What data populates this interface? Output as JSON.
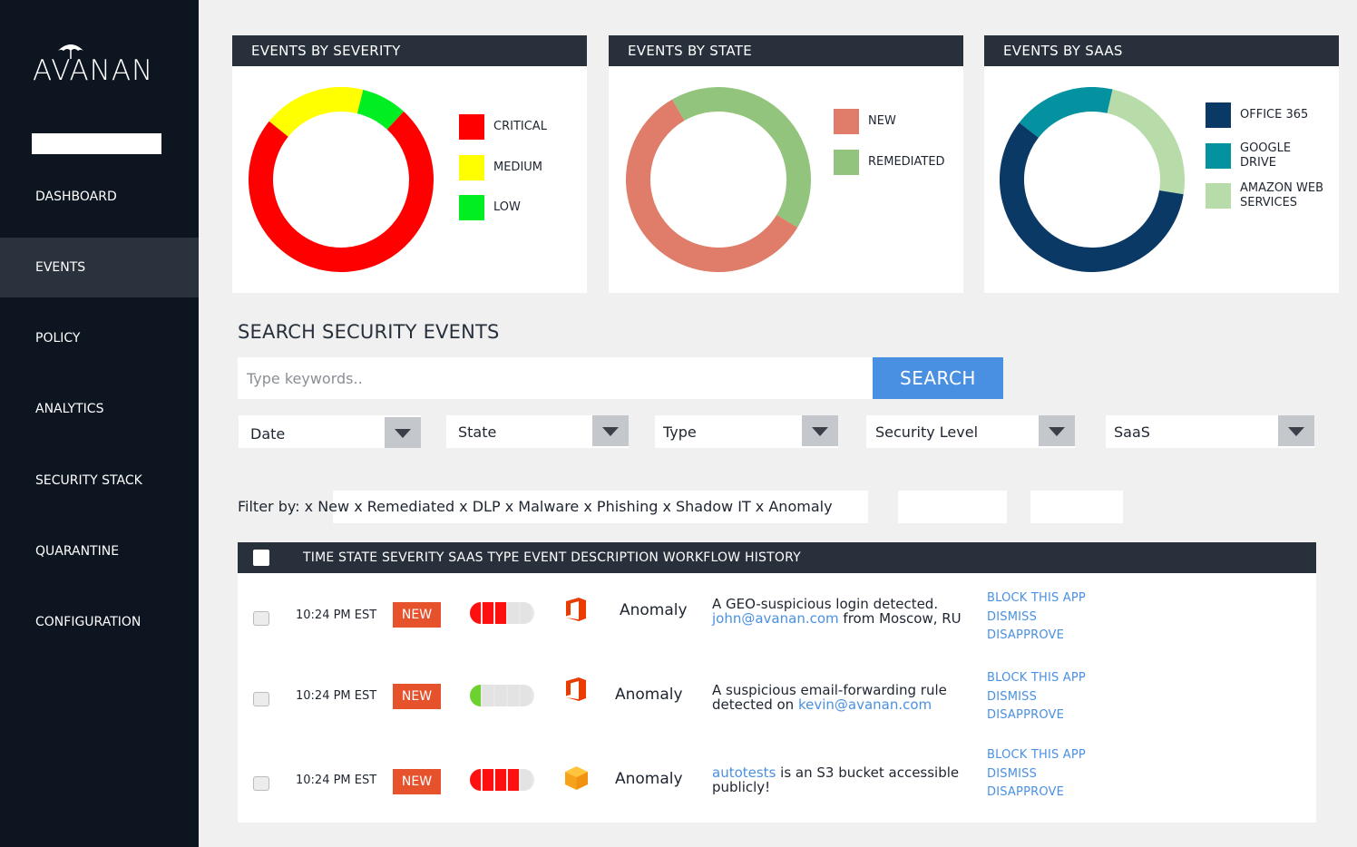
{
  "app": {
    "name": "AVANAN"
  },
  "sidebar": {
    "search_value": "",
    "items": [
      {
        "label": "DASHBOARD",
        "active": false
      },
      {
        "label": "EVENTS",
        "active": true
      },
      {
        "label": "POLICY",
        "active": false
      },
      {
        "label": "ANALYTICS",
        "active": false
      },
      {
        "label": "SECURITY STACK",
        "active": false
      },
      {
        "label": "QUARANTINE",
        "active": false
      },
      {
        "label": "CONFIGURATION",
        "active": false
      }
    ]
  },
  "panels": [
    {
      "title": "EVENTS BY SEVERITY",
      "legend": [
        {
          "label": "CRITICAL",
          "color": "#ff0000"
        },
        {
          "label": "MEDIUM",
          "color": "#ffff00"
        },
        {
          "label": "LOW",
          "color": "#00ee22"
        }
      ]
    },
    {
      "title": "EVENTS BY STATE",
      "legend": [
        {
          "label": "NEW",
          "color": "#e07d6a"
        },
        {
          "label": "REMEDIATED",
          "color": "#93c47d"
        }
      ]
    },
    {
      "title": "EVENTS BY SAAS",
      "legend": [
        {
          "label": "OFFICE 365",
          "color": "#0b3966"
        },
        {
          "label": "GOOGLE DRIVE",
          "color": "#0592a0"
        },
        {
          "label": "AMAZON WEB SERVICES",
          "color": "#b7dba9"
        }
      ]
    }
  ],
  "chart_data": [
    {
      "type": "pie",
      "title": "EVENTS BY SEVERITY",
      "categories": [
        "MEDIUM",
        "LOW",
        "CRITICAL"
      ],
      "values": [
        18,
        8,
        74
      ]
    },
    {
      "type": "pie",
      "title": "EVENTS BY STATE",
      "categories": [
        "REMEDIATED",
        "NEW"
      ],
      "values": [
        42,
        58
      ]
    },
    {
      "type": "pie",
      "title": "EVENTS BY SAAS",
      "categories": [
        "GOOGLE DRIVE",
        "AMAZON WEB SERVICES",
        "OFFICE 365"
      ],
      "values": [
        18,
        24,
        58
      ]
    }
  ],
  "search": {
    "title": "SEARCH SECURITY EVENTS",
    "placeholder": "Type keywords..",
    "value": "",
    "button_label": "SEARCH"
  },
  "dropdowns": [
    {
      "label": "Date"
    },
    {
      "label": "State"
    },
    {
      "label": "Type"
    },
    {
      "label": "Security Level"
    },
    {
      "label": "SaaS"
    }
  ],
  "filters": {
    "text": "Filter by: x New x Remediated x DLP x Malware x Phishing x Shadow IT x Anomaly"
  },
  "table": {
    "header": "TIME STATE SEVERITY SAAS TYPE EVENT DESCRIPTION WORKFLOW HISTORY",
    "rows": [
      {
        "time": "10:24 PM EST",
        "state": "NEW",
        "severity_level": 3,
        "severity_color": "#ff1010",
        "saas_icon": "office365-icon",
        "type": "Anomaly",
        "desc_before": "A GEO-suspicious login detected.",
        "desc_link": "john@avanan.com",
        "desc_after": " from Moscow, RU",
        "actions": [
          "BLOCK THIS APP",
          "DISMISS",
          "DISAPPROVE"
        ]
      },
      {
        "time": "10:24 PM EST",
        "state": "NEW",
        "severity_level": 1,
        "severity_color": "#6dd12f",
        "saas_icon": "office365-icon",
        "type": "Anomaly",
        "desc_before": "A suspicious email-forwarding rule detected on ",
        "desc_link": "kevin@avanan.com",
        "desc_after": "",
        "actions": [
          "BLOCK THIS APP",
          "DISMISS",
          "DISAPPROVE"
        ]
      },
      {
        "time": "10:24 PM EST",
        "state": "NEW",
        "severity_level": 4,
        "severity_color": "#ff1010",
        "saas_icon": "aws-icon",
        "type": "Anomaly",
        "desc_before": "",
        "desc_link": "autotests",
        "desc_after": " is an S3 bucket accessible publicly!",
        "actions": [
          "BLOCK THIS APP",
          "DISMISS",
          "DISAPPROVE"
        ]
      }
    ]
  }
}
